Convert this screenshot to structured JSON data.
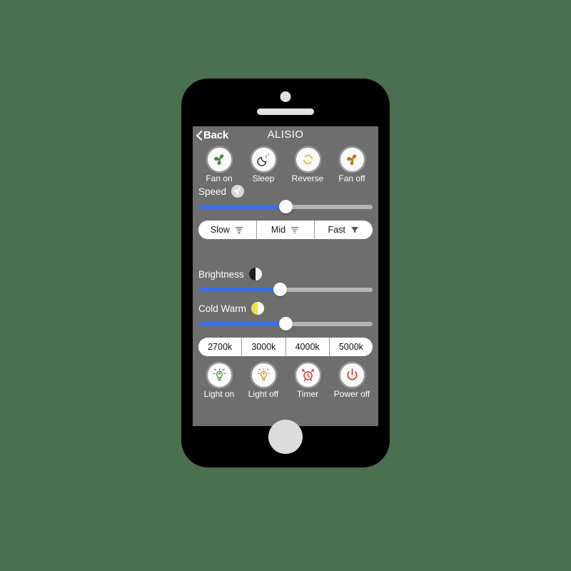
{
  "background_color": "#4a7050",
  "device": {
    "name": "smartphone-mockup",
    "body_color": "#000000",
    "screen_bg": "#6e6e6e"
  },
  "nav": {
    "back_label": "Back",
    "back_icon": "chevron-left-icon",
    "title": "ALISIO"
  },
  "fan_buttons": [
    {
      "label": "Fan on",
      "icon": "fan-icon",
      "color": "#4c8a3a"
    },
    {
      "label": "Sleep",
      "icon": "moon-sleep-icon",
      "color": "#2c2c2c"
    },
    {
      "label": "Reverse",
      "icon": "refresh-circle-icon",
      "color": "#e8c020"
    },
    {
      "label": "Fan off",
      "icon": "fan-icon",
      "color": "#c07a10"
    }
  ],
  "speed": {
    "label": "Speed",
    "badge_icon": "fan-badge-icon",
    "slider": {
      "value": 50,
      "fill_color": "#3b6ee8",
      "track_color": "#b4b4b4"
    },
    "options": [
      {
        "label": "Slow",
        "icon": "tornado-slow-icon"
      },
      {
        "label": "Mid",
        "icon": "tornado-mid-icon"
      },
      {
        "label": "Fast",
        "icon": "tornado-fast-icon"
      }
    ]
  },
  "brightness": {
    "label": "Brightness",
    "badge_icon": "half-circle-bw-icon",
    "slider": {
      "value": 47,
      "fill_color": "#3b6ee8",
      "track_color": "#b4b4b4"
    }
  },
  "cold_warm": {
    "label": "Cold Warm",
    "badge_icon": "half-circle-yellow-icon",
    "slider": {
      "value": 50,
      "fill_color": "#3b6ee8",
      "track_color": "#b4b4b4"
    }
  },
  "kelvin": {
    "options": [
      {
        "label": "2700k"
      },
      {
        "label": "3000k"
      },
      {
        "label": "4000k"
      },
      {
        "label": "5000k"
      }
    ]
  },
  "light_buttons": [
    {
      "label": "Light on",
      "icon": "lightbulb-icon",
      "color": "#4c8a3a"
    },
    {
      "label": "Light off",
      "icon": "lightbulb-icon",
      "color": "#d39b16"
    },
    {
      "label": "Timer",
      "icon": "alarm-clock-icon",
      "color": "#d02d2d"
    },
    {
      "label": "Power off",
      "icon": "power-icon",
      "color": "#d02d2d"
    }
  ]
}
